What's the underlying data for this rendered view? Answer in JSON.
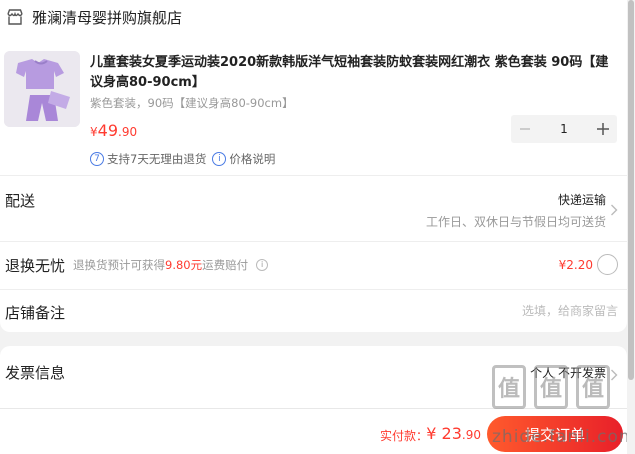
{
  "shop": {
    "icon": "store-icon",
    "name": "雅澜清母婴拼购旗舰店"
  },
  "product": {
    "title": "儿童套装女夏季运动装2020新款韩版洋气短袖套装防蚊套装网红潮衣 紫色套装 90码【建议身高80-90cm】",
    "spec": "紫色套装，90码【建议身高80-90cm】",
    "price_currency": "¥",
    "price_int": "49",
    "price_dec": ".90",
    "quantity": "1",
    "minus_icon": "minus-icon",
    "plus_icon": "plus-icon",
    "services": [
      {
        "icon": "seven-day-return-icon",
        "glyph": "7",
        "label": "支持7天无理由退货"
      },
      {
        "icon": "info-icon",
        "glyph": "i",
        "label": "价格说明"
      }
    ]
  },
  "delivery": {
    "label": "配送",
    "method": "快递运输",
    "note": "工作日、双休日与节假日均可送货"
  },
  "return_insurance": {
    "label": "退换无忧",
    "desc_prefix": "退换货预计可获得",
    "desc_amount": "9.80元",
    "desc_suffix": "运费赔付",
    "price": "¥2.20"
  },
  "remarks": {
    "label": "店铺备注",
    "placeholder": "选填，给商家留言"
  },
  "invoice": {
    "label": "发票信息",
    "value": "个人 不开发票"
  },
  "footer": {
    "pay_label": "实付款：",
    "pay_currency": "¥",
    "pay_int": "23",
    "pay_dec": ".90",
    "submit_label": "提交订单"
  },
  "watermark": {
    "glyph": "值",
    "text": "zhide.fanli.com"
  },
  "colors": {
    "accent": "#ff3b30",
    "info_blue": "#4a7be4",
    "button_start": "#ff5a2c",
    "button_end": "#e8202a"
  }
}
